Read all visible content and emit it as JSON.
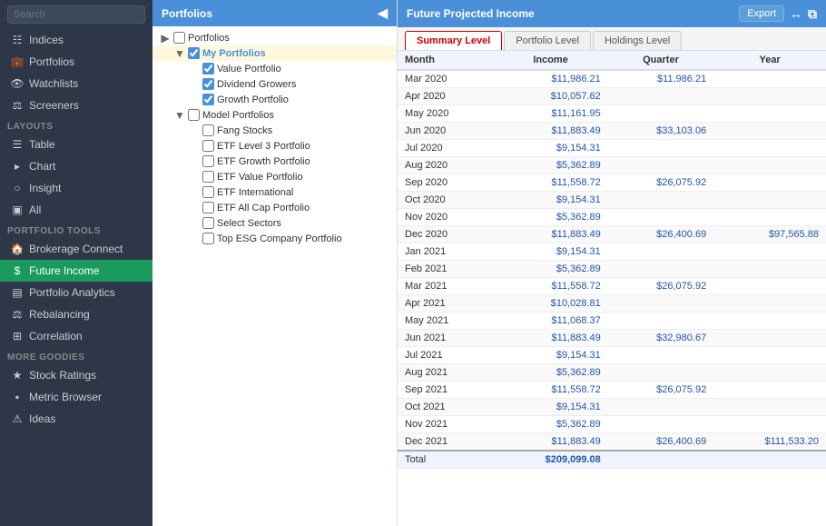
{
  "sidebar": {
    "search_placeholder": "Search",
    "items_top": [
      {
        "label": "Indices",
        "icon": "chart-bar-icon",
        "active": false
      },
      {
        "label": "Portfolios",
        "icon": "briefcase-icon",
        "active": false
      },
      {
        "label": "Watchlists",
        "icon": "eye-icon",
        "active": false
      },
      {
        "label": "Screeners",
        "icon": "filter-icon",
        "active": false
      }
    ],
    "layouts_label": "Layouts",
    "layout_items": [
      {
        "label": "Table",
        "icon": "table-icon",
        "active": false
      },
      {
        "label": "Chart",
        "icon": "chart-icon",
        "active": false
      },
      {
        "label": "Insight",
        "icon": "insight-icon",
        "active": false
      },
      {
        "label": "All",
        "icon": "all-icon",
        "active": false
      }
    ],
    "portfolio_tools_label": "Portfolio Tools",
    "tool_items": [
      {
        "label": "Brokerage Connect",
        "icon": "bank-icon",
        "active": false
      },
      {
        "label": "Future Income",
        "icon": "dollar-icon",
        "active": true
      },
      {
        "label": "Portfolio Analytics",
        "icon": "analytics-icon",
        "active": false
      },
      {
        "label": "Rebalancing",
        "icon": "scale-icon",
        "active": false
      },
      {
        "label": "Correlation",
        "icon": "grid-icon",
        "active": false
      }
    ],
    "more_goodies_label": "More Goodies",
    "goodies_items": [
      {
        "label": "Stock Ratings",
        "icon": "star-icon",
        "active": false
      },
      {
        "label": "Metric Browser",
        "icon": "metrics-icon",
        "active": false
      },
      {
        "label": "Ideas",
        "icon": "lightbulb-icon",
        "active": false
      }
    ]
  },
  "middle": {
    "header": "Portfolios",
    "tree": [
      {
        "level": 1,
        "label": "Portfolios",
        "checked": null,
        "toggle": "▶",
        "bold": false
      },
      {
        "level": 2,
        "label": "My Portfolios",
        "checked": true,
        "toggle": "▼",
        "bold": true,
        "blue": true
      },
      {
        "level": 3,
        "label": "Value Portfolio",
        "checked": true,
        "toggle": "",
        "bold": false
      },
      {
        "level": 3,
        "label": "Dividend Growers",
        "checked": true,
        "toggle": "",
        "bold": false
      },
      {
        "level": 3,
        "label": "Growth Portfolio",
        "checked": true,
        "toggle": "",
        "bold": false
      },
      {
        "level": 2,
        "label": "Model Portfolios",
        "checked": false,
        "toggle": "▼",
        "bold": false
      },
      {
        "level": 3,
        "label": "Fang Stocks",
        "checked": false,
        "toggle": "",
        "bold": false
      },
      {
        "level": 3,
        "label": "ETF Level 3 Portfolio",
        "checked": false,
        "toggle": "",
        "bold": false
      },
      {
        "level": 3,
        "label": "ETF Growth Portfolio",
        "checked": false,
        "toggle": "",
        "bold": false
      },
      {
        "level": 3,
        "label": "ETF Value Portfolio",
        "checked": false,
        "toggle": "",
        "bold": false
      },
      {
        "level": 3,
        "label": "ETF International",
        "checked": false,
        "toggle": "",
        "bold": false
      },
      {
        "level": 3,
        "label": "ETF All Cap Portfolio",
        "checked": false,
        "toggle": "",
        "bold": false
      },
      {
        "level": 3,
        "label": "Select Sectors",
        "checked": false,
        "toggle": "",
        "bold": false
      },
      {
        "level": 3,
        "label": "Top ESG Company Portfolio",
        "checked": false,
        "toggle": "",
        "bold": false
      }
    ]
  },
  "right": {
    "title": "Future Projected Income",
    "export_label": "Export",
    "tabs": [
      {
        "label": "Summary Level",
        "active": true
      },
      {
        "label": "Portfolio Level",
        "active": false
      },
      {
        "label": "Holdings Level",
        "active": false
      }
    ],
    "columns": [
      "Month",
      "Income",
      "Quarter",
      "Year"
    ],
    "rows": [
      {
        "month": "Mar 2020",
        "income": "$11,986.21",
        "quarter": "$11,986.21",
        "year": ""
      },
      {
        "month": "Apr 2020",
        "income": "$10,057.62",
        "quarter": "",
        "year": ""
      },
      {
        "month": "May 2020",
        "income": "$11,161.95",
        "quarter": "",
        "year": ""
      },
      {
        "month": "Jun 2020",
        "income": "$11,883.49",
        "quarter": "$33,103.06",
        "year": ""
      },
      {
        "month": "Jul 2020",
        "income": "$9,154.31",
        "quarter": "",
        "year": ""
      },
      {
        "month": "Aug 2020",
        "income": "$5,362.89",
        "quarter": "",
        "year": ""
      },
      {
        "month": "Sep 2020",
        "income": "$11,558.72",
        "quarter": "$26,075.92",
        "year": ""
      },
      {
        "month": "Oct 2020",
        "income": "$9,154.31",
        "quarter": "",
        "year": ""
      },
      {
        "month": "Nov 2020",
        "income": "$5,362.89",
        "quarter": "",
        "year": ""
      },
      {
        "month": "Dec 2020",
        "income": "$11,883.49",
        "quarter": "$26,400.69",
        "year": "$97,565.88"
      },
      {
        "month": "Jan 2021",
        "income": "$9,154.31",
        "quarter": "",
        "year": ""
      },
      {
        "month": "Feb 2021",
        "income": "$5,362.89",
        "quarter": "",
        "year": ""
      },
      {
        "month": "Mar 2021",
        "income": "$11,558.72",
        "quarter": "$26,075.92",
        "year": ""
      },
      {
        "month": "Apr 2021",
        "income": "$10,028.81",
        "quarter": "",
        "year": ""
      },
      {
        "month": "May 2021",
        "income": "$11,068.37",
        "quarter": "",
        "year": ""
      },
      {
        "month": "Jun 2021",
        "income": "$11,883.49",
        "quarter": "$32,980.67",
        "year": ""
      },
      {
        "month": "Jul 2021",
        "income": "$9,154.31",
        "quarter": "",
        "year": ""
      },
      {
        "month": "Aug 2021",
        "income": "$5,362.89",
        "quarter": "",
        "year": ""
      },
      {
        "month": "Sep 2021",
        "income": "$11,558.72",
        "quarter": "$26,075.92",
        "year": ""
      },
      {
        "month": "Oct 2021",
        "income": "$9,154.31",
        "quarter": "",
        "year": ""
      },
      {
        "month": "Nov 2021",
        "income": "$5,362.89",
        "quarter": "",
        "year": ""
      },
      {
        "month": "Dec 2021",
        "income": "$11,883.49",
        "quarter": "$26,400.69",
        "year": "$111,533.20"
      }
    ],
    "total_label": "Total",
    "total_income": "$209,099.08"
  }
}
